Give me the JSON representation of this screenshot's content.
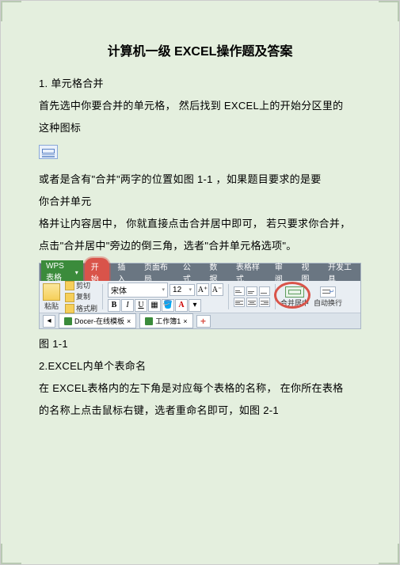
{
  "title": "计算机一级  EXCEL操作题及答案",
  "section1_header": "1. 单元格合并",
  "p1": "首先选中你要合并的单元格，   然后找到  EXCEL上的开始分区里的",
  "p2": "这种图标",
  "p3": "或者是含有\"合并\"两字的位置如图    1-1 ，如果题目要求的是要",
  "p4": "你合并单元",
  "p5": "格并让内容居中，  你就直接点击合并居中即可，  若只要求你合并，",
  "p6": "点击\"合并居中\"旁边的倒三角，选者\"合并单元格选项\"。",
  "fig1_label": "图 1-1",
  "section2_header": "2.EXCEL内单个表命名",
  "p7": "在 EXCEL表格内的左下角是对应每个表格的名称，    在你所在表格",
  "p8": "的名称上点击鼠标右键，选者重命名即可，如图      2-1",
  "ribbon": {
    "app": "WPS 表格",
    "tabs": [
      "开始",
      "插入",
      "页面布局",
      "公式",
      "数据",
      "表格样式",
      "审阅",
      "视图",
      "开发工具"
    ],
    "paste": "粘贴",
    "cut": "剪切",
    "copy": "复制",
    "painter": "格式刷",
    "font": "宋体",
    "fontsize": "12",
    "merge": "合并居中",
    "wrap": "自动换行",
    "b": "B",
    "i": "I",
    "u": "U",
    "doc1": "Docer-在线模板",
    "doc2": "工作簿1",
    "close": "×"
  }
}
